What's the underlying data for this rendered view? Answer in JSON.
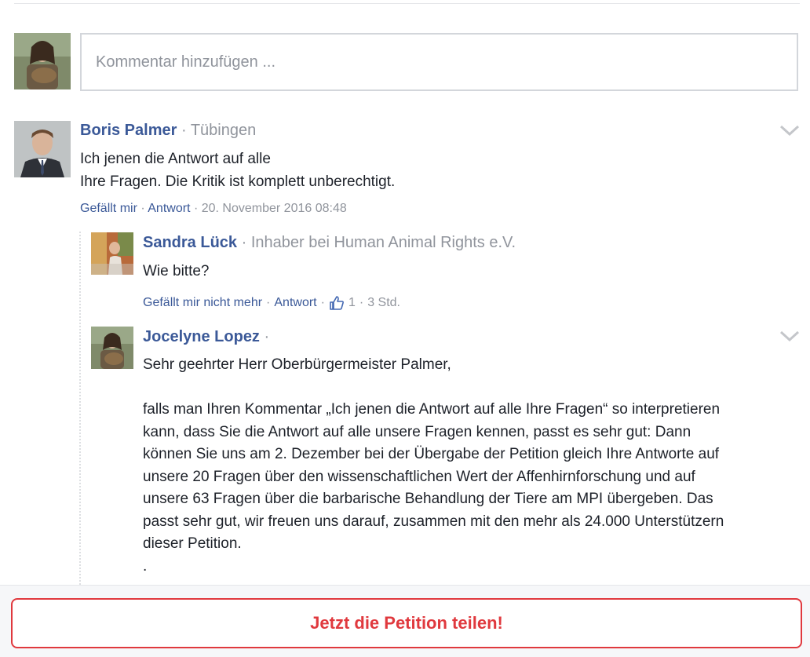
{
  "composer": {
    "placeholder": "Kommentar hinzufügen ..."
  },
  "comments": [
    {
      "author": "Boris Palmer",
      "separator": "·",
      "subtitle": "Tübingen",
      "lines": [
        "Ich jenen die Antwort auf alle",
        "Ihre Fragen. Die Kritik ist komplett unberechtigt."
      ],
      "like_label": "Gefällt mir",
      "dot": "·",
      "reply_label": "Antwort",
      "timestamp": "20. November 2016 08:48"
    }
  ],
  "replies": [
    {
      "author": "Sandra Lück",
      "separator": "·",
      "subtitle": "Inhaber bei Human Animal Rights e.V.",
      "lines": [
        "Wie bitte?"
      ],
      "like_label": "Gefällt mir nicht mehr",
      "dot": "·",
      "reply_label": "Antwort",
      "like_count": "1",
      "time": "3 Std."
    },
    {
      "author": "Jocelyne Lopez",
      "separator": "·",
      "lines": [
        "Sehr geehrter Herr Oberbürgermeister Palmer,",
        "",
        "falls man Ihren Kommentar „Ich jenen die Antwort auf alle Ihre Fragen“ so interpretieren",
        "kann, dass Sie die Antwort auf alle unsere Fragen kennen, passt es sehr gut: Dann",
        "können Sie uns am 2. Dezember bei der Übergabe der Petition gleich Ihre Antworte auf",
        "unsere 20 Fragen über den wissenschaftlichen Wert der Affenhirnforschung und auf",
        "unsere 63 Fragen über die barbarische Behandlung der Tiere am MPI übergeben. Das",
        "passt sehr gut, wir freuen uns darauf, zusammen mit den mehr als 24.000 Unterstützern",
        "dieser Petition.",
        "."
      ]
    }
  ],
  "footer": {
    "share_label": "Jetzt die Petition teilen!"
  },
  "colors": {
    "link": "#3b5998",
    "meta": "#90949c",
    "accent": "#e0393e"
  },
  "icons": {
    "chevron": "chevron-down-icon",
    "thumb": "thumbs-up-icon"
  }
}
